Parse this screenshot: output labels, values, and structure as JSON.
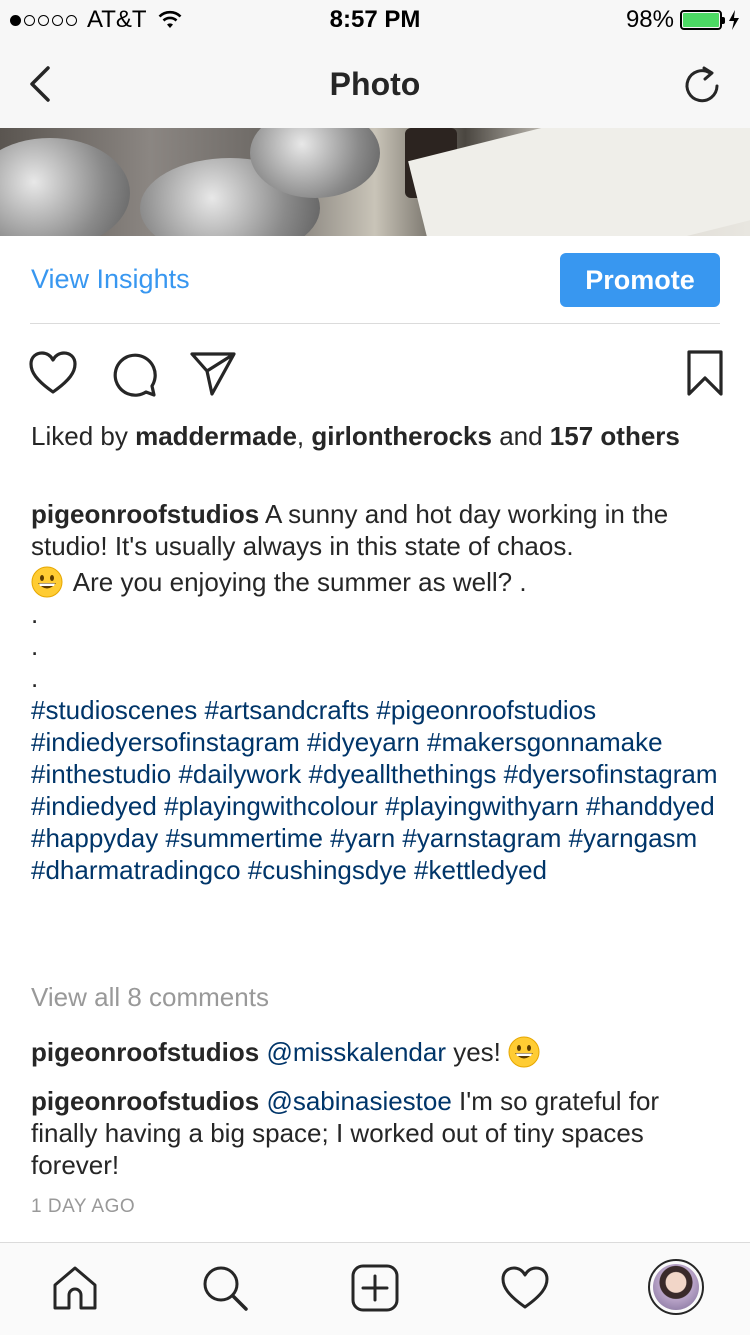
{
  "status_bar": {
    "carrier": "AT&T",
    "time": "8:57 PM",
    "battery": "98%",
    "signal_bars_filled": 1,
    "signal_bars_total": 5
  },
  "nav": {
    "title": "Photo"
  },
  "actions": {
    "view_insights": "View Insights",
    "promote": "Promote"
  },
  "likes": {
    "prefix": "Liked by ",
    "user1": "maddermade",
    "separator": ", ",
    "user2": "girlontherocks",
    "middle": " and ",
    "count": "157 others"
  },
  "caption": {
    "username": "pigeonroofstudios",
    "text": " A sunny and hot day working in the studio! It's usually always in this state of chaos.",
    "text2": " Are you enjoying the summer as well? .",
    "dots": [
      ".",
      ".",
      "."
    ],
    "hashtags": "#studioscenes #artsandcrafts #pigeonroofstudios #indiedyersofinstagram #idyeyarn #makersgonnamake #inthestudio #dailywork #dyeallthethings #dyersofinstagram #indiedyed #playingwithcolour #playingwithyarn #handdyed #happyday #summertime #yarn #yarnstagram #yarngasm #dharmatradingco #cushingsdye #kettledyed"
  },
  "view_all_comments": "View all 8 comments",
  "comments": [
    {
      "username": "pigeonroofstudios",
      "mention": "@misskalendar",
      "text": " yes! "
    },
    {
      "username": "pigeonroofstudios",
      "mention": "@sabinasiestoe",
      "text": " I'm so grateful for finally having a big space; I worked out of tiny spaces forever!"
    }
  ],
  "timestamp": "1 DAY AGO",
  "colors": {
    "link_blue": "#3897f0",
    "hashtag_navy": "#003569",
    "muted_gray": "#999999",
    "battery_green": "#4cd964"
  },
  "icons": [
    "back-icon",
    "refresh-icon",
    "heart-icon",
    "comment-icon",
    "share-icon",
    "bookmark-icon",
    "home-icon",
    "search-icon",
    "add-icon",
    "activity-icon",
    "profile-avatar"
  ]
}
